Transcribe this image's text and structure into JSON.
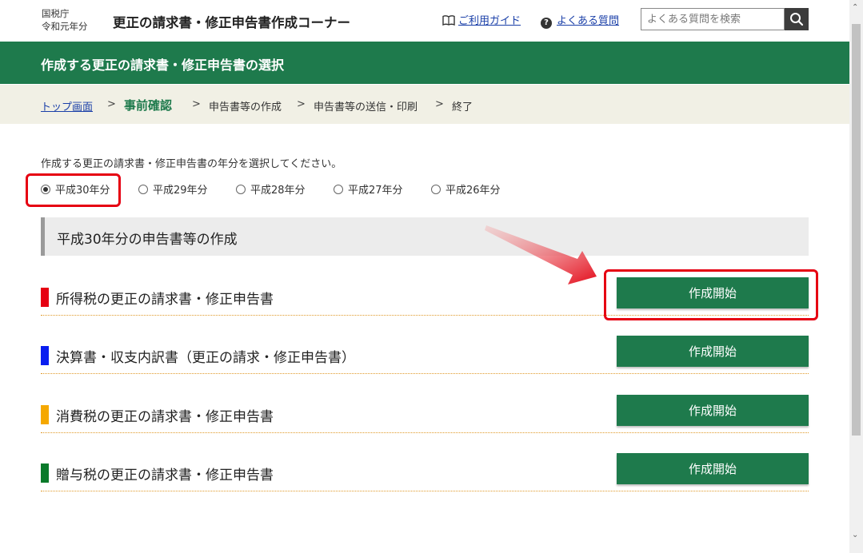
{
  "header": {
    "agency_line1": "国税庁",
    "agency_line2": "令和元年分",
    "app_title": "更正の請求書・修正申告書作成コーナー",
    "guide_link": "ご利用ガイド",
    "faq_link": "よくある質問",
    "search_placeholder": "よくある質問を検索",
    "icons": {
      "guide": "book-icon",
      "faq": "question-circle-icon",
      "search": "search-icon"
    }
  },
  "banner": {
    "title": "作成する更正の請求書・修正申告書の選択"
  },
  "breadcrumb": {
    "items": [
      "トップ画面",
      "事前確認",
      "申告書等の作成",
      "申告書等の送信・印刷",
      "終了"
    ],
    "current_index": 1
  },
  "main": {
    "instruction": "作成する更正の請求書・修正申告書の年分を選択してください。",
    "year_options": [
      {
        "label": "平成30年分",
        "selected": true
      },
      {
        "label": "平成29年分",
        "selected": false
      },
      {
        "label": "平成28年分",
        "selected": false
      },
      {
        "label": "平成27年分",
        "selected": false
      },
      {
        "label": "平成26年分",
        "selected": false
      }
    ],
    "section_title": "平成30年分の申告書等の作成",
    "rows": [
      {
        "label": "所得税の更正の請求書・修正申告書",
        "button": "作成開始",
        "bar_color": "#e60012",
        "highlighted": true
      },
      {
        "label": "決算書・収支内訳書（更正の請求・修正申告書）",
        "button": "作成開始",
        "bar_color": "#0a1ef0",
        "highlighted": false
      },
      {
        "label": "消費税の更正の請求書・修正申告書",
        "button": "作成開始",
        "bar_color": "#f5a800",
        "highlighted": false
      },
      {
        "label": "贈与税の更正の請求書・修正申告書",
        "button": "作成開始",
        "bar_color": "#0a7a2a",
        "highlighted": false
      }
    ]
  },
  "colors": {
    "brand_green": "#1e7a4c",
    "highlight_red": "#e60012",
    "link_blue": "#1a3fa8"
  }
}
